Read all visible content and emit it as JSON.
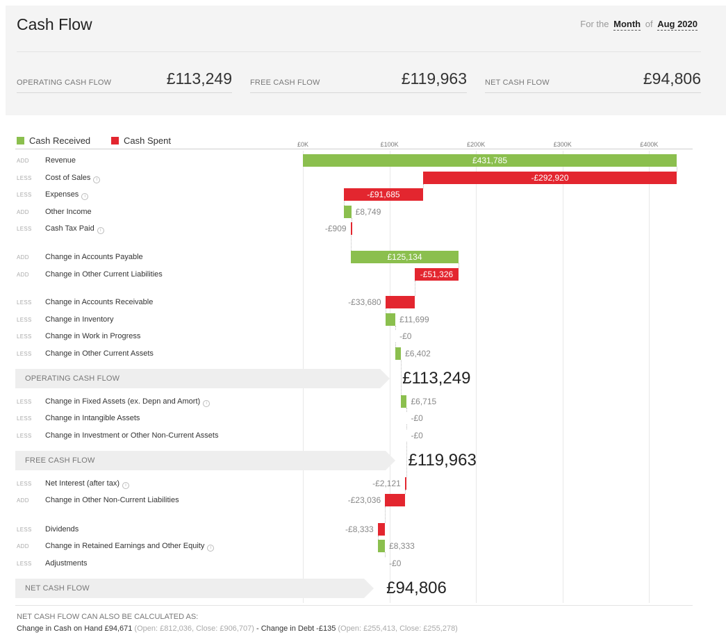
{
  "header": {
    "title": "Cash Flow",
    "period": {
      "prefix": "For the",
      "granularity": "Month",
      "of": "of",
      "selected": "Aug 2020"
    }
  },
  "metrics": [
    {
      "label": "OPERATING CASH FLOW",
      "value": "£113,249"
    },
    {
      "label": "FREE CASH FLOW",
      "value": "£119,963"
    },
    {
      "label": "NET CASH FLOW",
      "value": "£94,806"
    }
  ],
  "legend": {
    "received": {
      "label": "Cash Received",
      "color": "#8bbf4e"
    },
    "spent": {
      "label": "Cash Spent",
      "color": "#e3262f"
    }
  },
  "chart_data": {
    "type": "bar",
    "subtype": "waterfall",
    "x_ticks": [
      "£0K",
      "£100K",
      "£200K",
      "£300K",
      "£400K"
    ],
    "xlim": [
      0,
      431785
    ],
    "grid": true,
    "legend_position": "top-left",
    "rows": [
      {
        "op": "ADD",
        "label": "Revenue",
        "value": 431785,
        "display": "£431,785",
        "start": 0,
        "end": 431785,
        "info": false
      },
      {
        "op": "LESS",
        "label": "Cost of Sales",
        "value": -292920,
        "display": "-£292,920",
        "start": 431785,
        "end": 138865,
        "info": true
      },
      {
        "op": "LESS",
        "label": "Expenses",
        "value": -91685,
        "display": "-£91,685",
        "start": 138865,
        "end": 47180,
        "info": true
      },
      {
        "op": "ADD",
        "label": "Other Income",
        "value": 8749,
        "display": "£8,749",
        "start": 47180,
        "end": 55929,
        "info": false
      },
      {
        "op": "LESS",
        "label": "Cash Tax Paid",
        "value": -909,
        "display": "-£909",
        "start": 55929,
        "end": 55020,
        "info": true
      },
      {
        "op": "ADD",
        "label": "Change in Accounts Payable",
        "value": 125134,
        "display": "£125,134",
        "start": 55020,
        "end": 180154,
        "info": false
      },
      {
        "op": "ADD",
        "label": "Change in Other Current Liabilities",
        "value": -51326,
        "display": "-£51,326",
        "start": 180154,
        "end": 128828,
        "info": false
      },
      {
        "op": "LESS",
        "label": "Change in Accounts Receivable",
        "value": -33680,
        "display": "-£33,680",
        "start": 128828,
        "end": 95148,
        "info": false
      },
      {
        "op": "LESS",
        "label": "Change in Inventory",
        "value": 11699,
        "display": "£11,699",
        "start": 95148,
        "end": 106847,
        "info": false
      },
      {
        "op": "LESS",
        "label": "Change in Work in Progress",
        "value": 0,
        "display": "-£0",
        "start": 106847,
        "end": 106847,
        "info": false
      },
      {
        "op": "LESS",
        "label": "Change in Other Current Assets",
        "value": 6402,
        "display": "£6,402",
        "start": 106847,
        "end": 113249,
        "info": false
      },
      {
        "subtotal": true,
        "label": "OPERATING CASH FLOW",
        "value": 113249,
        "display": "£113,249"
      },
      {
        "op": "LESS",
        "label": "Change in Fixed Assets (ex. Depn and Amort)",
        "value": 6715,
        "display": "£6,715",
        "start": 113249,
        "end": 119964,
        "info": true
      },
      {
        "op": "LESS",
        "label": "Change in Intangible Assets",
        "value": 0,
        "display": "-£0",
        "start": 119964,
        "end": 119964,
        "info": false
      },
      {
        "op": "LESS",
        "label": "Change in Investment or Other Non-Current Assets",
        "value": 0,
        "display": "-£0",
        "start": 119964,
        "end": 119964,
        "info": false
      },
      {
        "subtotal": true,
        "label": "FREE CASH FLOW",
        "value": 119963,
        "display": "£119,963"
      },
      {
        "op": "LESS",
        "label": "Net Interest (after tax)",
        "value": -2121,
        "display": "-£2,121",
        "start": 119963,
        "end": 117842,
        "info": true
      },
      {
        "op": "ADD",
        "label": "Change in Other Non-Current Liabilities",
        "value": -23036,
        "display": "-£23,036",
        "start": 117842,
        "end": 94806,
        "info": false
      },
      {
        "op": "LESS",
        "label": "Dividends",
        "value": -8333,
        "display": "-£8,333",
        "start": 94806,
        "end": 86473,
        "info": false
      },
      {
        "op": "ADD",
        "label": "Change in Retained Earnings and Other Equity",
        "value": 8333,
        "display": "£8,333",
        "start": 86473,
        "end": 94806,
        "info": true
      },
      {
        "op": "LESS",
        "label": "Adjustments",
        "value": 0,
        "display": "-£0",
        "start": 94806,
        "end": 94806,
        "info": false
      },
      {
        "subtotal": true,
        "label": "NET CASH FLOW",
        "value": 94806,
        "display": "£94,806"
      }
    ]
  },
  "footer": {
    "heading": "NET CASH FLOW CAN ALSO BE CALCULATED AS:",
    "line_a": "Change in Cash on Hand £94,671",
    "line_a_detail": "(Open: £812,036, Close: £906,707)",
    "separator": "-",
    "line_b": "Change in Debt -£135",
    "line_b_detail": "(Open: £255,413, Close: £255,278)"
  }
}
